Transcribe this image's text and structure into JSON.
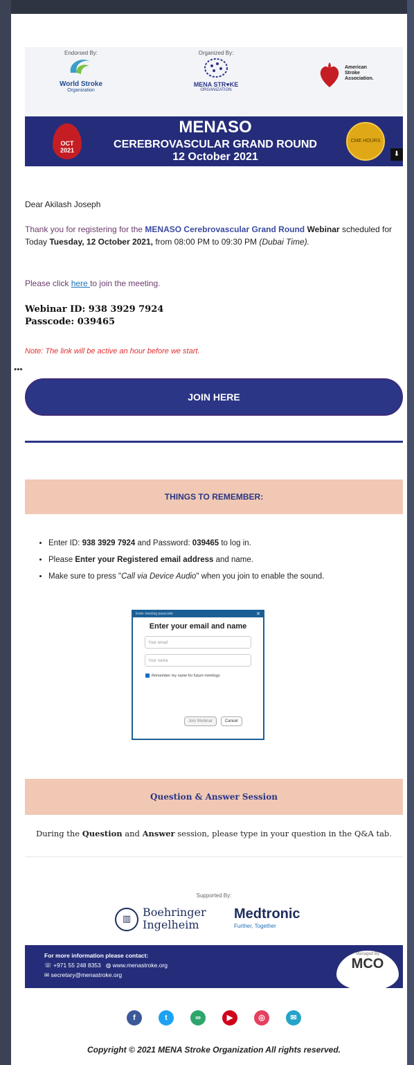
{
  "header": {
    "endorsed_label": "Endorsed By:",
    "organized_label": "Organized By:",
    "wso_title": "World Stroke",
    "wso_sub": "Organization",
    "menaso_logo_text": "MENA STR♥KE",
    "menaso_logo_sub": "ORGANIZATION",
    "asa_text": "American\nStroke\nAssociation.",
    "banner_title": "MENASO",
    "banner_subtitle": "CEREBROVASCULAR GRAND ROUND",
    "banner_date": "12 October 2021",
    "oct_month": "OCT",
    "oct_year": "2021",
    "cme_text": "CME HOURS",
    "download_icon": "download-icon"
  },
  "body": {
    "greeting": "Dear Akilash Joseph",
    "reg_prefix": "Thank you for registering for the ",
    "reg_event": "MENASO Cerebrovascular Grand Round",
    "reg_webinar": " Webinar",
    "reg_mid": " scheduled for Today ",
    "reg_date": "Tuesday, 12 October 2021,",
    "reg_time": " from 08:00 PM to 09:30 PM ",
    "reg_tz": "(Dubai Time).",
    "click_prefix": "Please click ",
    "click_link": "here ",
    "click_suffix": "to join the meeting.",
    "webinar_id": "Webinar ID:  938 3929 7924",
    "passcode": "Passcode: 039465",
    "note": "Note: The link will be active an hour before we start.",
    "ellipsis": "•••",
    "join_button": "JOIN HERE"
  },
  "things": {
    "title": "THINGS TO REMEMBER:",
    "items": [
      {
        "pre": "Enter ID: ",
        "b1": "938 3929 7924",
        "mid": " and Password: ",
        "b2": "039465",
        "post": " to log in."
      },
      {
        "pre": "Please ",
        "b1": "Enter your Registered email address",
        "mid": " and name.",
        "b2": "",
        "post": ""
      },
      {
        "pre": "Make sure to press \"",
        "b1": "Call via Device Audio",
        "mid": "\" when you join to enable the sound.",
        "b2": "",
        "post": ""
      }
    ]
  },
  "dialog": {
    "bar_text": "Enter meeting passcode",
    "title": "Enter your email and name",
    "email_placeholder": "Your email",
    "name_placeholder": "Your name",
    "remember": "Remember my name for future meetings",
    "join_btn": "Join Webinar",
    "cancel_btn": "Cancel"
  },
  "qa": {
    "title": "Question & Answer Session",
    "pre": "During the ",
    "b1": "Question",
    "mid": " and ",
    "b2": "Answer",
    "post": " session, please type in your question in the Q&A tab."
  },
  "sponsors": {
    "supported_label": "Supported By:",
    "bi_line1": "Boehringer",
    "bi_line2": "Ingelheim",
    "medtronic": "Medtronic",
    "medtronic_tag": "Further, Together"
  },
  "contact": {
    "title": "For more information please contact:",
    "phone": "☏ +971 55 248 8353",
    "web": "◍ www.menastroke.org",
    "email": "✉ secretary@menastroke.org",
    "managed_by": "Managed By",
    "mco": "MCO"
  },
  "socials": [
    {
      "icon": "facebook-icon",
      "glyph": "f",
      "color": "#3b5998"
    },
    {
      "icon": "twitter-icon",
      "glyph": "t",
      "color": "#1da1f2"
    },
    {
      "icon": "link-icon",
      "glyph": "∞",
      "color": "#2ea56b"
    },
    {
      "icon": "youtube-icon",
      "glyph": "▶",
      "color": "#d0021b"
    },
    {
      "icon": "instagram-icon",
      "glyph": "◎",
      "color": "#e4405f"
    },
    {
      "icon": "email-icon",
      "glyph": "✉",
      "color": "#27a3c9"
    }
  ],
  "copyright": "Copyright © 2021 MENA Stroke Organization All rights reserved.",
  "colors": {
    "navy": "#252d7a",
    "peach": "#f0c8b4",
    "note_red": "#e03030"
  }
}
